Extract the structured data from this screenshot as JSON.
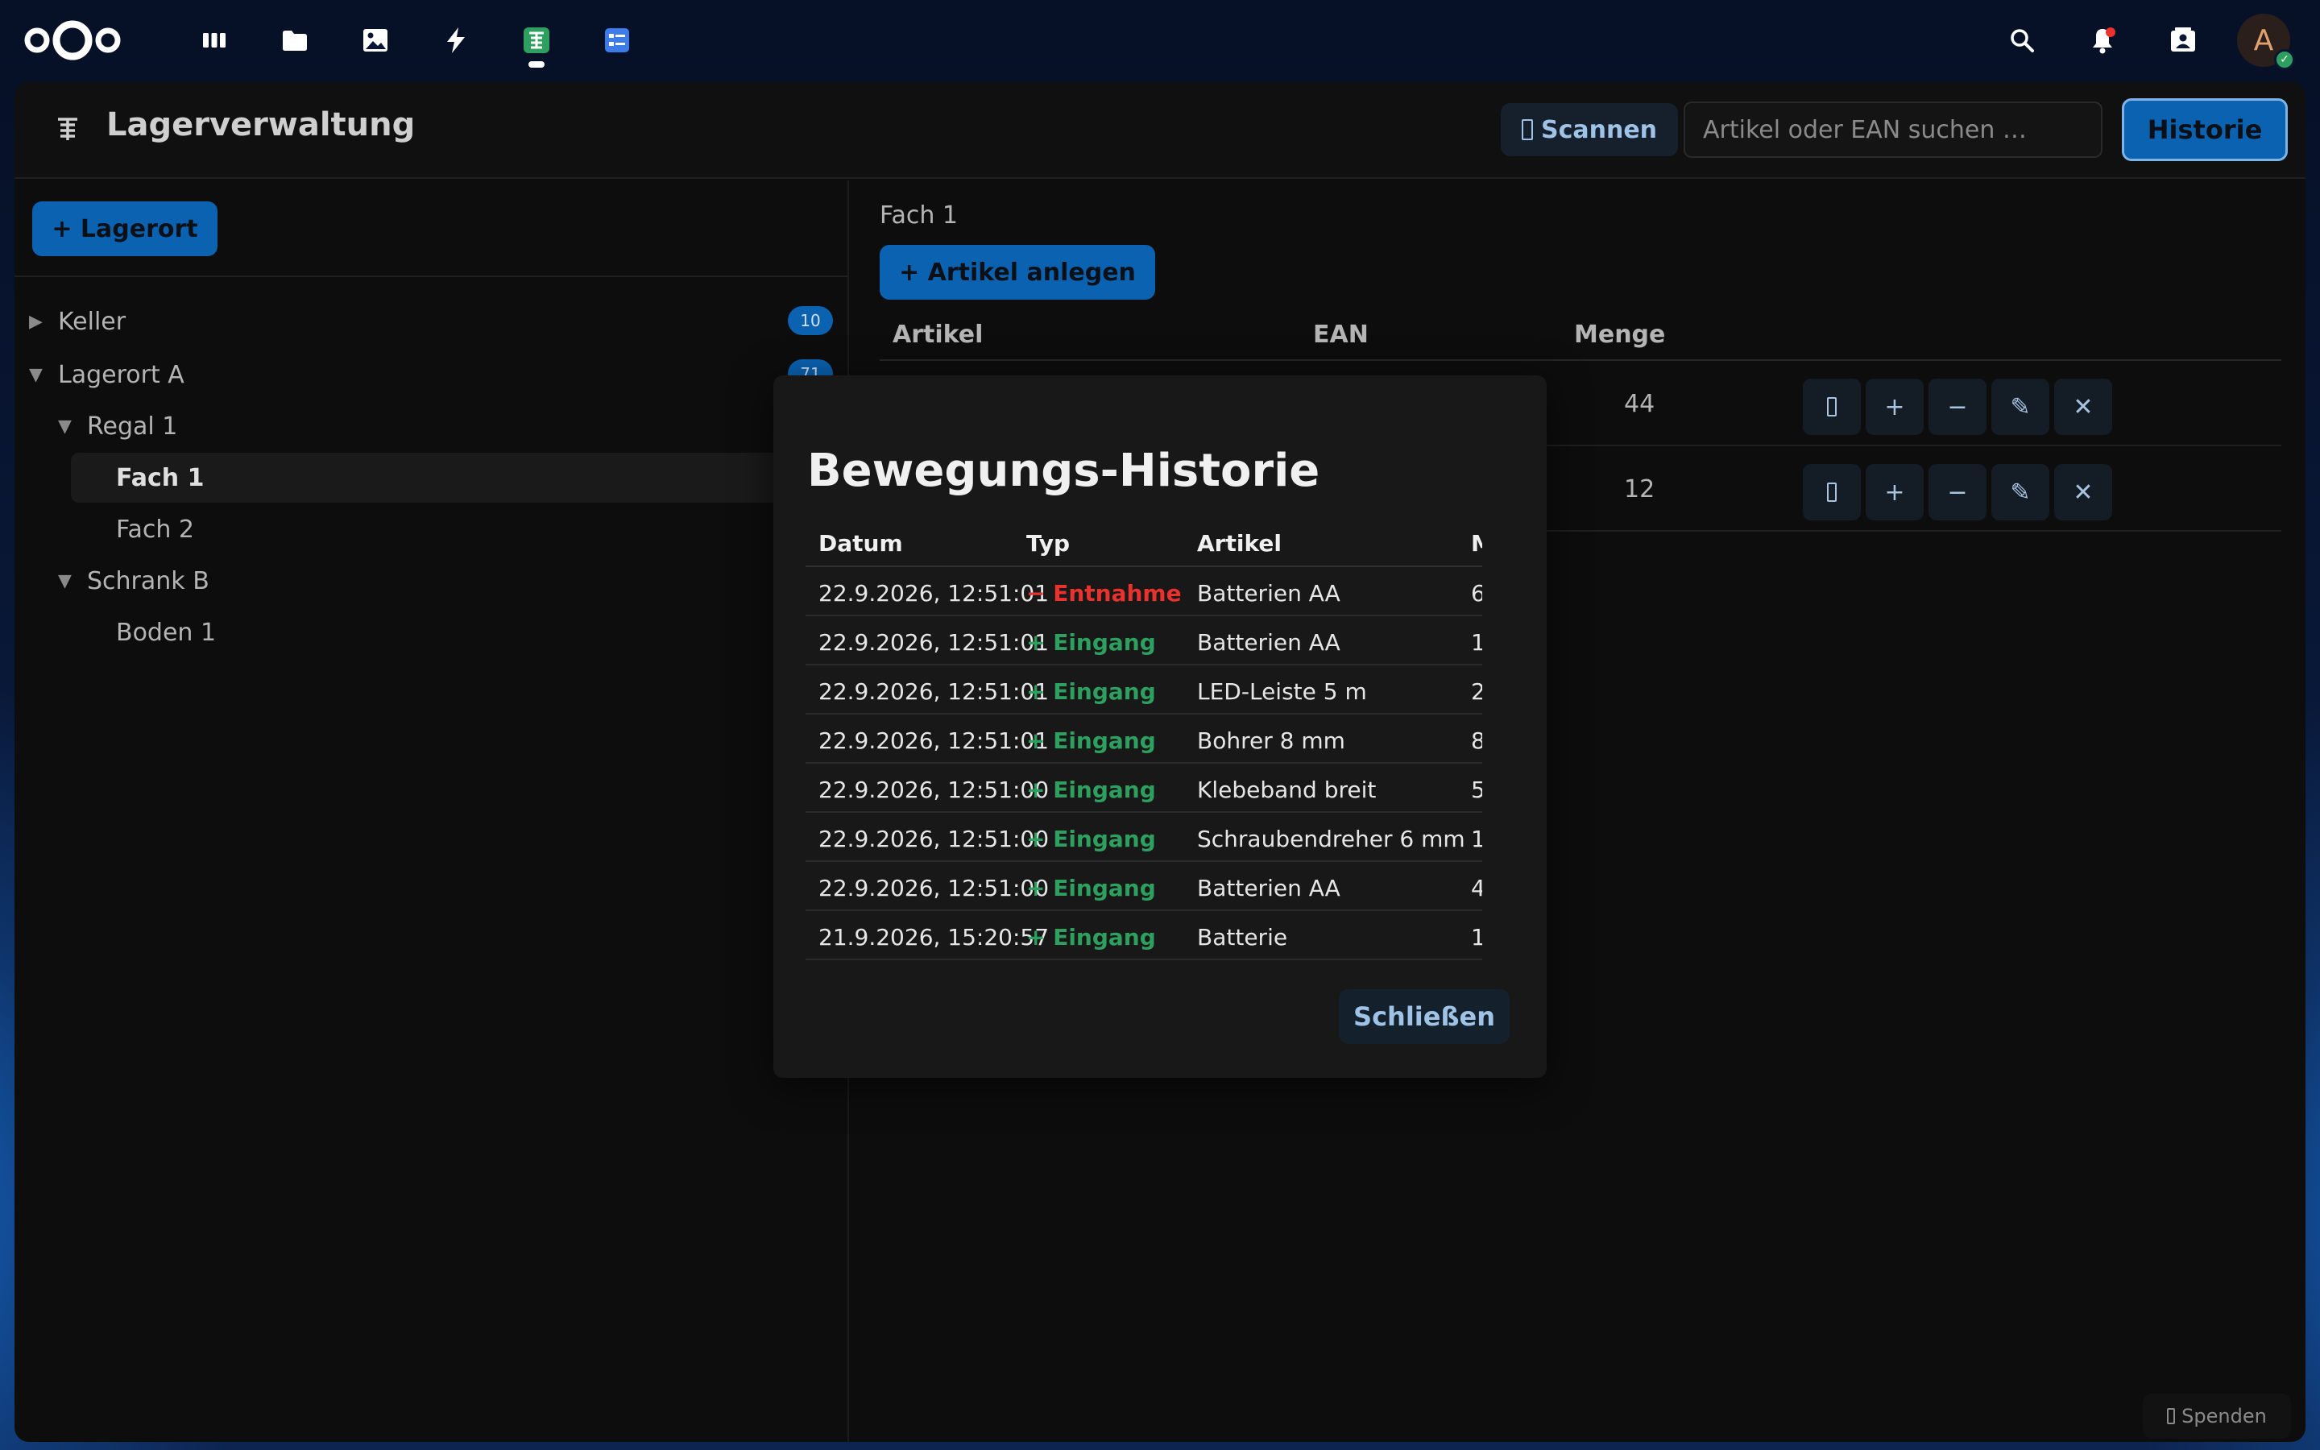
{
  "header": {
    "apps": [
      {
        "name": "dashboard-icon"
      },
      {
        "name": "files-icon"
      },
      {
        "name": "photos-icon"
      },
      {
        "name": "activity-icon"
      },
      {
        "name": "lagerverwaltung-app-icon"
      },
      {
        "name": "forms-icon"
      }
    ],
    "avatar_initial": "A"
  },
  "app": {
    "title": "Lagerverwaltung",
    "scan_label": "Scannen",
    "search_placeholder": "Artikel oder EAN suchen …",
    "history_label": "Historie",
    "add_location_label": "+ Lagerort"
  },
  "tree": [
    {
      "label": "Keller",
      "arrow": "▶",
      "badge": "10"
    },
    {
      "label": "Lagerort A",
      "arrow": "▼",
      "badge": "71"
    },
    {
      "label": "Regal 1",
      "arrow": "▼"
    },
    {
      "label": "Fach 1"
    },
    {
      "label": "Fach 2"
    },
    {
      "label": "Schrank B",
      "arrow": "▼"
    },
    {
      "label": "Boden 1"
    }
  ],
  "main": {
    "breadcrumb": "Fach 1",
    "add_article_label": "+ Artikel anlegen",
    "columns": [
      "Artikel",
      "EAN",
      "Menge"
    ],
    "rows": [
      {
        "qty": "44"
      },
      {
        "qty": "12"
      }
    ],
    "action_symbols": {
      "plus": "+",
      "minus": "−",
      "edit": "✎",
      "delete": "✕"
    }
  },
  "modal": {
    "title": "Bewegungs-Historie",
    "columns": [
      "Datum",
      "Typ",
      "Artikel",
      "M"
    ],
    "rows": [
      {
        "date": "22.9.2026, 12:51:01",
        "type": "− Entnahme",
        "kind": "out",
        "article": "Batterien AA",
        "qty": "6"
      },
      {
        "date": "22.9.2026, 12:51:01",
        "type": "+ Eingang",
        "kind": "in",
        "article": "Batterien AA",
        "qty": "1"
      },
      {
        "date": "22.9.2026, 12:51:01",
        "type": "+ Eingang",
        "kind": "in",
        "article": "LED-Leiste 5 m",
        "qty": "2"
      },
      {
        "date": "22.9.2026, 12:51:01",
        "type": "+ Eingang",
        "kind": "in",
        "article": "Bohrer 8 mm",
        "qty": "8"
      },
      {
        "date": "22.9.2026, 12:51:00",
        "type": "+ Eingang",
        "kind": "in",
        "article": "Klebeband breit",
        "qty": "5"
      },
      {
        "date": "22.9.2026, 12:51:00",
        "type": "+ Eingang",
        "kind": "in",
        "article": "Schraubendreher 6 mm",
        "qty": "1"
      },
      {
        "date": "22.9.2026, 12:51:00",
        "type": "+ Eingang",
        "kind": "in",
        "article": "Batterien AA",
        "qty": "4"
      },
      {
        "date": "21.9.2026, 15:20:57",
        "type": "+ Eingang",
        "kind": "in",
        "article": "Batterie",
        "qty": "1"
      }
    ],
    "close_label": "Schließen"
  },
  "footer": {
    "donate_label": "Spenden"
  }
}
